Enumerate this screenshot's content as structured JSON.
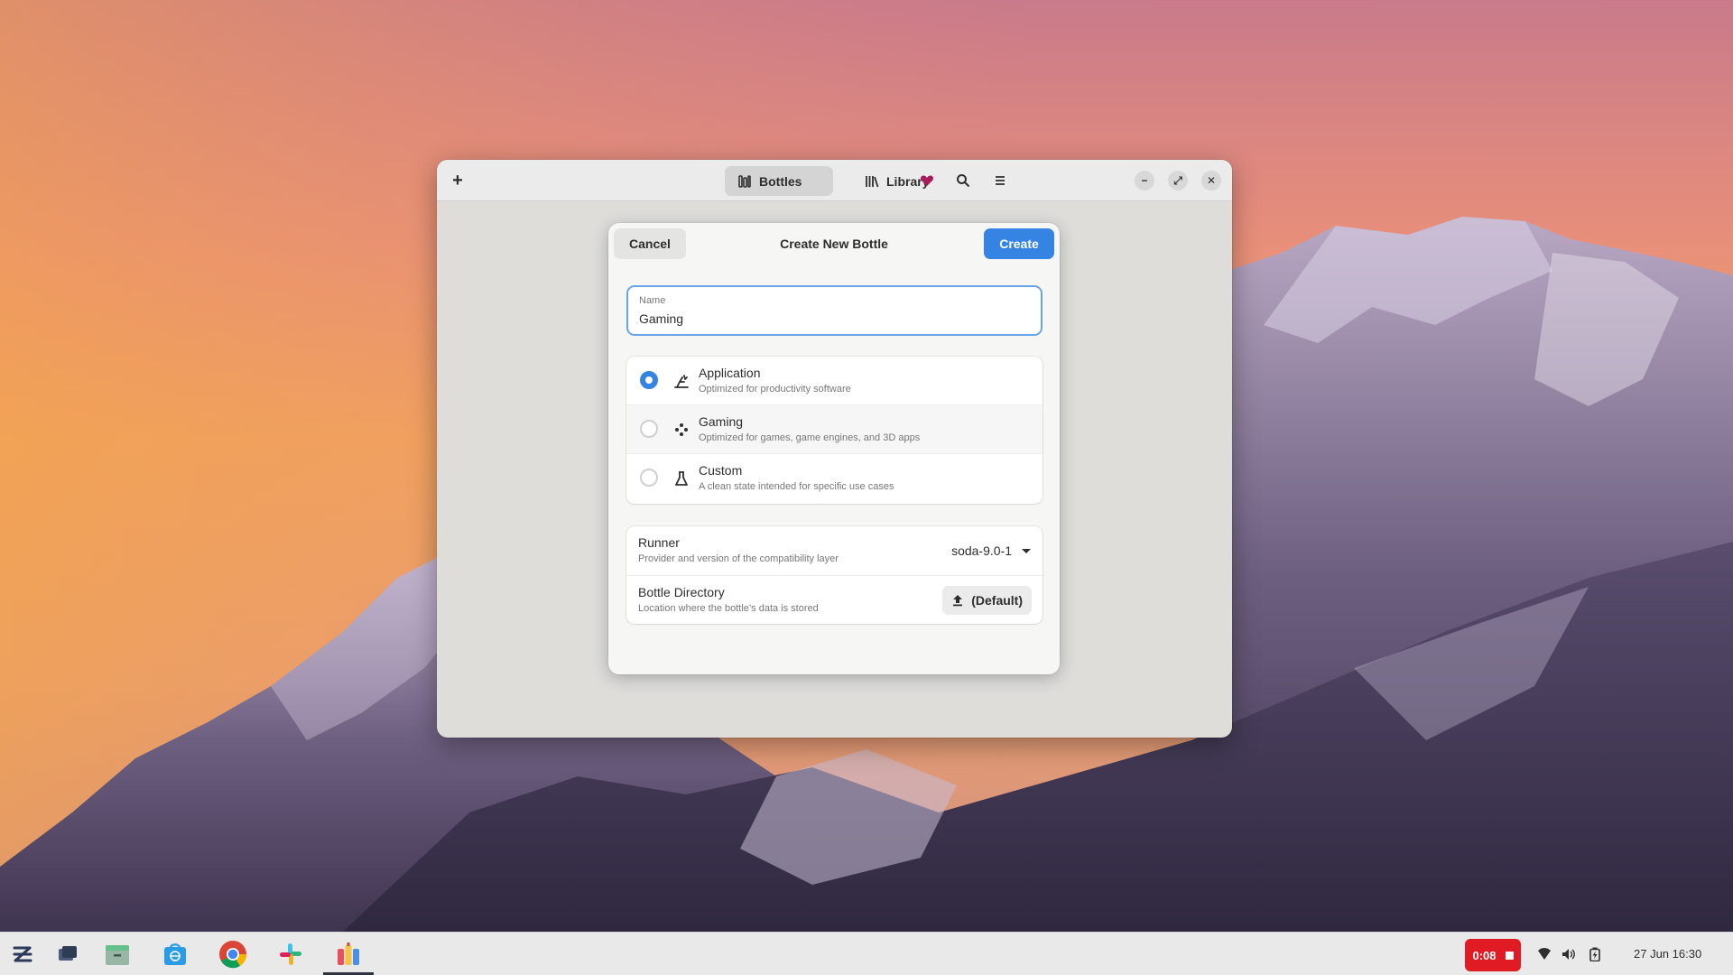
{
  "window": {
    "tabs": [
      {
        "label": "Bottles",
        "icon": "bottles-icon",
        "active": true
      },
      {
        "label": "Library",
        "icon": "library-icon",
        "active": false
      }
    ],
    "controls": [
      "heart-icon",
      "search-icon",
      "menu-icon",
      "minimize-icon",
      "maximize-icon",
      "close-icon"
    ]
  },
  "dialog": {
    "title": "Create New Bottle",
    "cancel_label": "Cancel",
    "create_label": "Create",
    "name_field": {
      "label": "Name",
      "value": "Gaming"
    },
    "environments": [
      {
        "title": "Application",
        "subtitle": "Optimized for productivity software",
        "icon": "application-icon",
        "selected": true
      },
      {
        "title": "Gaming",
        "subtitle": "Optimized for games, game engines, and 3D apps",
        "icon": "gaming-icon",
        "selected": false
      },
      {
        "title": "Custom",
        "subtitle": "A clean state intended for specific use cases",
        "icon": "custom-icon",
        "selected": false
      }
    ],
    "runner": {
      "title": "Runner",
      "subtitle": "Provider and version of the compatibility layer",
      "value": "soda-9.0-1"
    },
    "bottle_directory": {
      "title": "Bottle Directory",
      "subtitle": "Location where the bottle’s data is stored",
      "button_label": "(Default)"
    }
  },
  "taskbar": {
    "apps": [
      "zorin-menu-icon",
      "workspace-icon",
      "files-icon",
      "software-store-icon",
      "chrome-icon",
      "slack-icon",
      "bottles-app-icon"
    ],
    "recording_time": "0:08",
    "tray": [
      "wifi-icon",
      "volume-icon",
      "battery-icon"
    ],
    "clock": "27 Jun  16:30"
  },
  "colors": {
    "accent": "#3584e4",
    "recording": "#e01b24"
  }
}
